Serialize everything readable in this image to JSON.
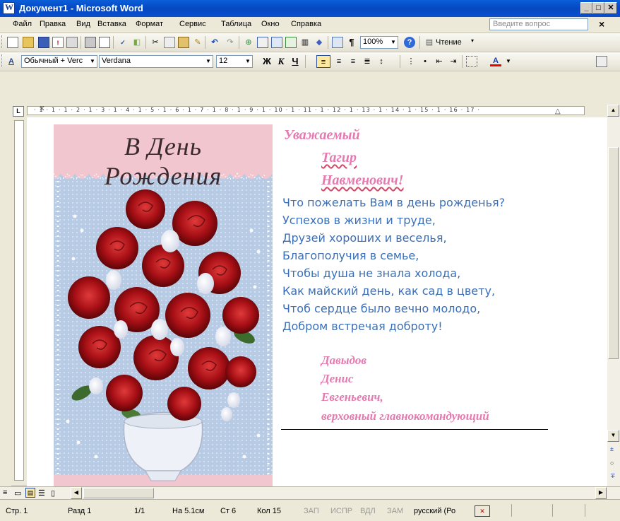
{
  "window": {
    "title": "Документ1 - Microsoft Word",
    "buttons": [
      "_",
      "□",
      "✕"
    ]
  },
  "menu": {
    "items": [
      "Файл",
      "Правка",
      "Вид",
      "Вставка",
      "Формат",
      "Сервис",
      "Таблица",
      "Окно",
      "Справка"
    ],
    "ask_placeholder": "Введите вопрос",
    "close": "×"
  },
  "standard_toolbar": {
    "zoom": "100%",
    "read_label": "Чтение",
    "pilcrow": "¶"
  },
  "format_toolbar": {
    "style": "Обычный + Verc",
    "font": "Verdana",
    "size": "12",
    "bold": "Ж",
    "italic": "К",
    "underline": "Ч",
    "font_color_label": "A"
  },
  "ruler": {
    "marks": "· 1 · 1 · 1 · 2 · 1 · 3 · 1 · 4 · 1 · 5 · 1 · 6 · 1 · 7 · 1 · 8 · 1 · 9 · 1 · 10 · 1 · 11 · 1 · 12 · 1 · 13 · 1 · 14 · 1 · 15 · 1 · 16 · 17 ·"
  },
  "card": {
    "heading": "В День Рождения"
  },
  "letter": {
    "greeting": "Уважаемый",
    "first_name": "Тагир",
    "patronymic": "Навменович!",
    "poem": [
      "Что пожелать Вам в день рожденья?",
      "Успехов в жизни и труде,",
      "Друзей хороших и веселья,",
      "Благополучия в семье,",
      "Чтобы душа не знала холода,",
      "Как майский день, как сад в цвету,",
      "Чтоб сердце было вечно молодо,",
      "Добром встречая доброту!"
    ],
    "signature": [
      "Давыдов",
      "Денис",
      "Евгеньевич,",
      "верховный главнокомандующий"
    ]
  },
  "status": {
    "page": "Стр. 1",
    "section": "Разд 1",
    "pages": "1/1",
    "at": "На 5.1см",
    "line": "Ст 6",
    "col": "Кол 15",
    "rec": "ЗАП",
    "trk": "ИСПР",
    "ext": "ВДЛ",
    "ovr": "ЗАМ",
    "lang": "русский (Ро"
  },
  "colors": {
    "accent_title": "#0548c0",
    "poem_text": "#3a6fb8",
    "name_text": "#e47ab0"
  }
}
